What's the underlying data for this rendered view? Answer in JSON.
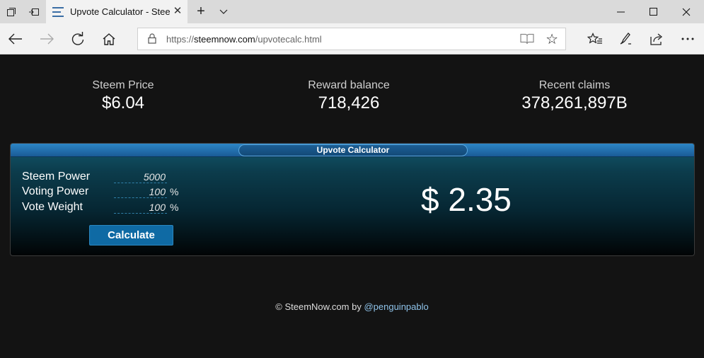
{
  "browser": {
    "tab_title": "Upvote Calculator - Steemnow",
    "url_prefix": "https://",
    "url_domain": "steemnow.com",
    "url_path": "/upvotecalc.html"
  },
  "stats": [
    {
      "label": "Steem Price",
      "value": "$6.04"
    },
    {
      "label": "Reward balance",
      "value": "718,426"
    },
    {
      "label": "Recent claims",
      "value": "378,261,897B"
    }
  ],
  "calculator": {
    "title": "Upvote Calculator",
    "fields": [
      {
        "label": "Steem Power",
        "value": "5000",
        "unit": ""
      },
      {
        "label": "Voting Power",
        "value": "100",
        "unit": "%"
      },
      {
        "label": "Vote Weight",
        "value": "100",
        "unit": "%"
      }
    ],
    "button_label": "Calculate",
    "result": "$ 2.35"
  },
  "footer": {
    "text": "© SteemNow.com by ",
    "author": "@penguinpablo"
  }
}
